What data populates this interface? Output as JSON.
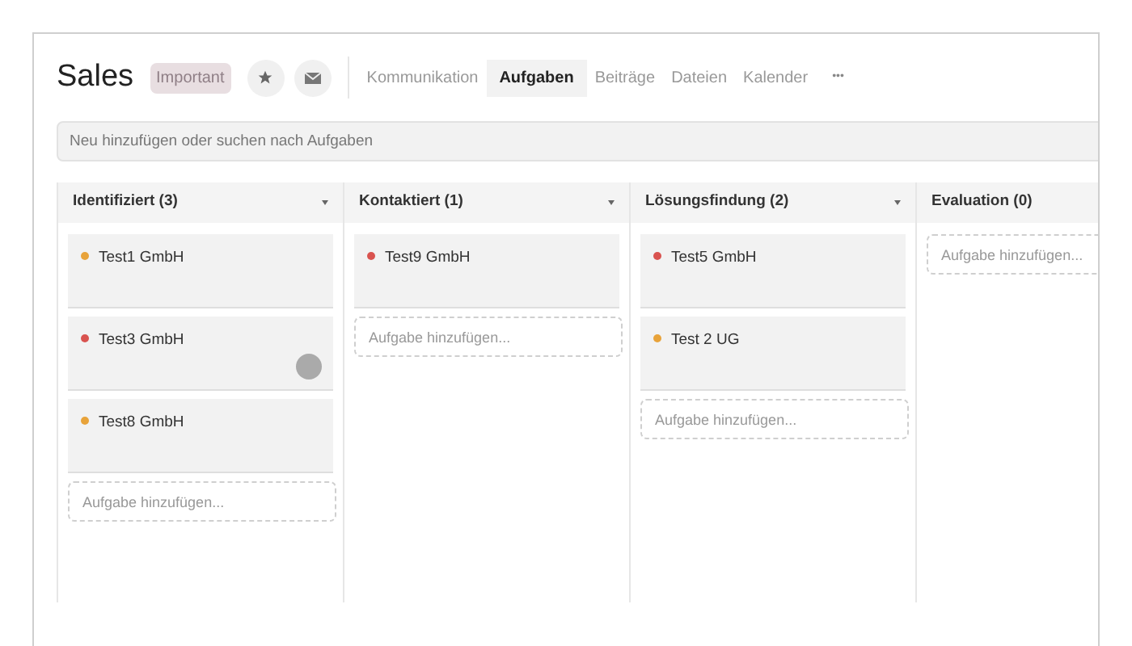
{
  "header": {
    "title": "Sales",
    "badge": "Important"
  },
  "tabs": [
    {
      "label": "Kommunikation",
      "selected": false
    },
    {
      "label": "Aufgaben",
      "selected": true
    },
    {
      "label": "Beiträge",
      "selected": false
    },
    {
      "label": "Dateien",
      "selected": false
    },
    {
      "label": "Kalender",
      "selected": false
    }
  ],
  "more_label": "•••",
  "search": {
    "placeholder": "Neu hinzufügen oder suchen nach Aufgaben"
  },
  "columns": [
    {
      "title": "Identifiziert (3)",
      "add_placeholder": "Aufgabe hinzufügen...",
      "cards": [
        {
          "title": "Test1 GmbH",
          "color": "#e8a33a",
          "avatar": false
        },
        {
          "title": "Test3 GmbH",
          "color": "#d9534f",
          "avatar": true
        },
        {
          "title": "Test8 GmbH",
          "color": "#e8a33a",
          "avatar": false
        }
      ]
    },
    {
      "title": "Kontaktiert (1)",
      "add_placeholder": "Aufgabe hinzufügen...",
      "cards": [
        {
          "title": "Test9 GmbH",
          "color": "#d9534f",
          "avatar": false
        }
      ]
    },
    {
      "title": "Lösungsfindung (2)",
      "add_placeholder": "Aufgabe hinzufügen...",
      "cards": [
        {
          "title": "Test5 GmbH",
          "color": "#d9534f",
          "avatar": false
        },
        {
          "title": "Test 2 UG",
          "color": "#e8a33a",
          "avatar": false
        }
      ]
    },
    {
      "title": "Evaluation (0)",
      "add_placeholder": "Aufgabe hinzufügen..."
    }
  ]
}
